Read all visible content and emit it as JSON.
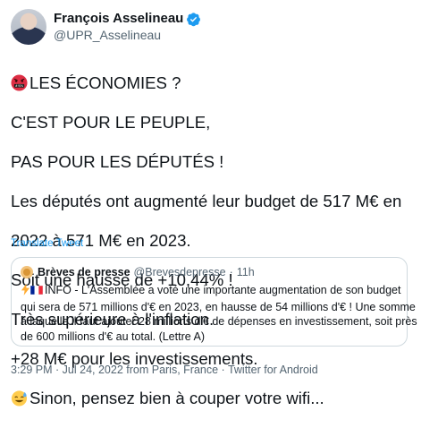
{
  "author": {
    "display_name": "François Asselineau",
    "handle": "@UPR_Asselineau",
    "verified_icon": "verified-badge-icon",
    "verified_color": "#1d9bf0"
  },
  "tweet": {
    "lines": [
      "LES ÉCONOMIES ?",
      "C'EST POUR LE PEUPLE,",
      "PAS POUR LES DÉPUTÉS !",
      "Les députés ont augmenté leur budget de 517 M€ en",
      "2022 à 571 M€ en 2023.",
      "Soit une hausse de +10,44% !",
      "Très supérieure à l'inflation.",
      "+28 M€ pour les investissements.",
      "Sinon, pensez bien à couper votre wifi..."
    ],
    "emoji_line1": "angry-face-with-symbols-icon",
    "emoji_line9": "sweat-smile-face-icon"
  },
  "translate_label": "Translate Tweet",
  "quote": {
    "avatar_icon": "cookie-avatar-icon",
    "display_name": "Brèves de presse",
    "handle": "@Brevesdepresse",
    "separator": "·",
    "time": "11h",
    "lines": [
      "INFO - L'Assemblée a voté une importante augmentation de son budget",
      "qui sera de 571 millions d'€ en 2023, en hausse de 54 millions d'€ ! Une somme",
      "à laquelle il faut ajouter 28 millions d'€ de dépenses en investissement, soit près",
      "de 600 millions d'€ au total. (Lettre A)"
    ],
    "lightning_icon": "lightning-icon",
    "flag_icon": "france-flag-icon"
  },
  "meta": {
    "time": "3:29 PM",
    "sep1": " · ",
    "date": "Jul 24, 2022 from Paris, France",
    "sep2": " · ",
    "source": "Twitter for Android"
  },
  "colors": {
    "link": "#1d9bf0",
    "secondary_text": "#536471",
    "border": "#cfd9de"
  }
}
